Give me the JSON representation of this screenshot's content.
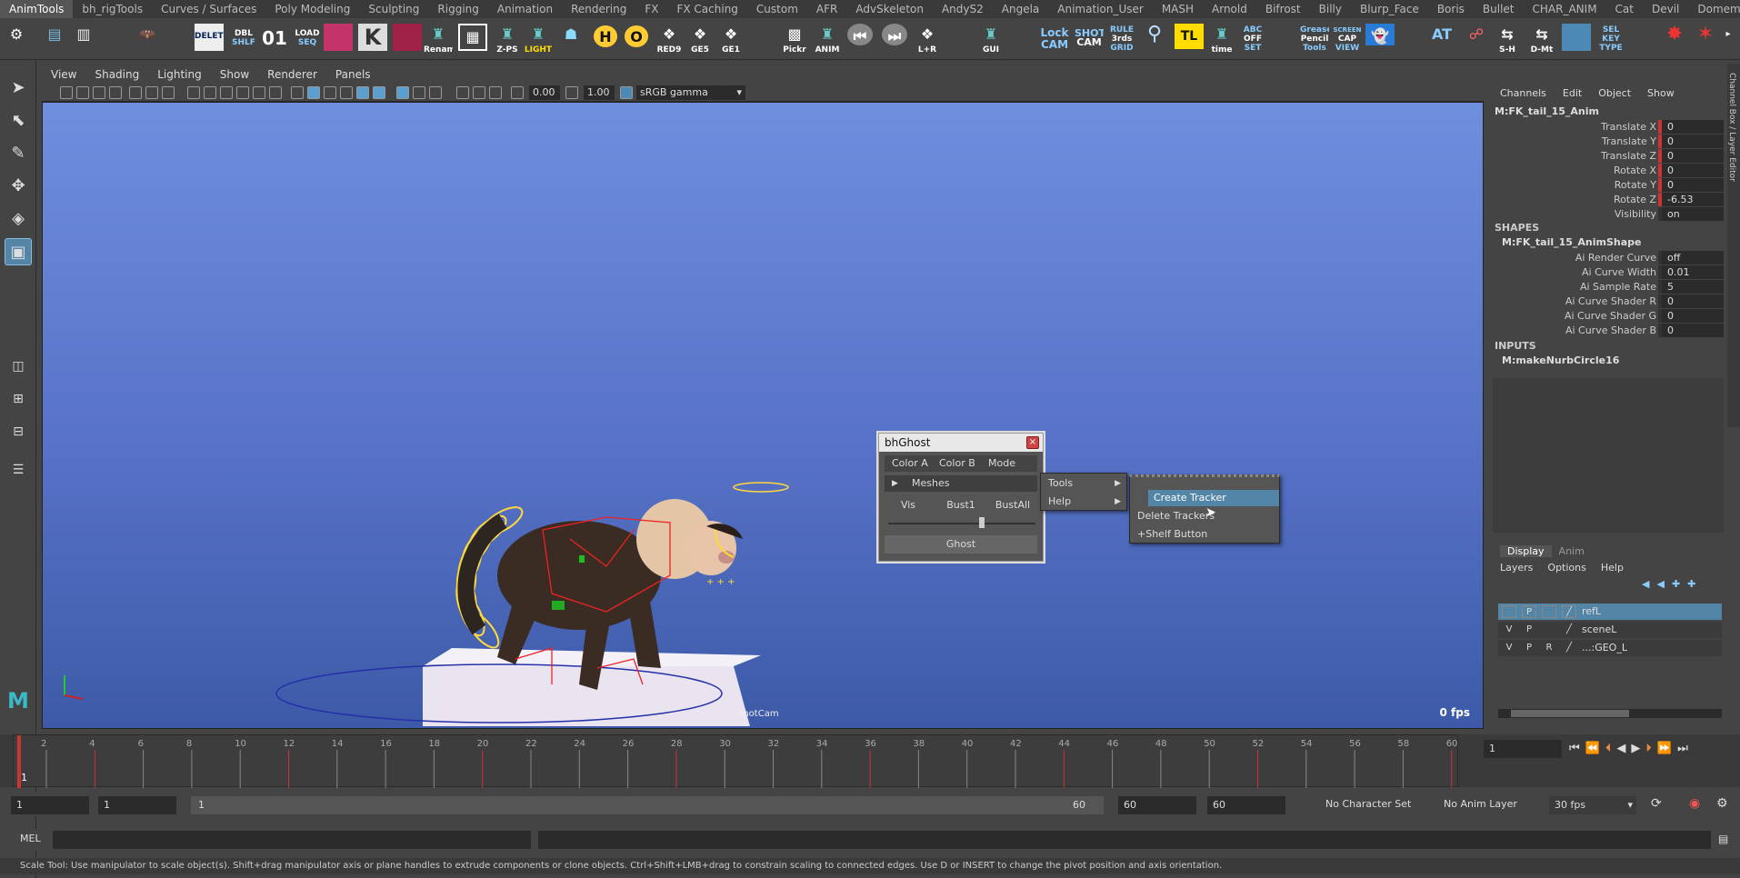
{
  "shelf_tabs": [
    "AnimTools",
    "bh_rigTools",
    "Curves / Surfaces",
    "Poly Modeling",
    "Sculpting",
    "Rigging",
    "Animation",
    "Rendering",
    "FX",
    "FX Caching",
    "Custom",
    "AFR",
    "AdvSkeleton",
    "AndyS2",
    "Angela",
    "Animation_User",
    "MASH",
    "Arnold",
    "Bifrost",
    "Billy",
    "Blurp_Face",
    "Boris",
    "Bullet",
    "CHAR_ANIM",
    "Cat",
    "Devil",
    "Domemaster"
  ],
  "shelf_icons": {
    "delete": "DELETE",
    "dbl": "DBL",
    "shlf": "SHLF",
    "num01": "01",
    "load": "LOAD",
    "seq": "SEQ",
    "rename": "Rename",
    "zps": "Z-PS",
    "light": "LIGHT",
    "h": "H",
    "o": "O",
    "red9": "RED9",
    "ge5": "GE5",
    "ge1": "GE1",
    "pickr": "Pickr",
    "anim": "ANIM",
    "lr": "L+R",
    "gui": "GUI",
    "lock": "Lock",
    "cam": "CAM",
    "shot": "SHOT",
    "shotcam2": "CAM",
    "rule": "RULE",
    "thirds": "3rds",
    "grid": "GRID",
    "tl": "TL",
    "time": "time",
    "abc": "ABC",
    "off": "OFF",
    "set": "SET",
    "grease": "Grease",
    "pencil": "Pencil",
    "tools": "Tools",
    "screen": "SCREEN",
    "cap": "CAP",
    "view": "VIEW",
    "at": "AT",
    "sh": "S-H",
    "dmt": "D-Mt",
    "sel": "SEL",
    "key": "KEY",
    "type": "TYPE"
  },
  "viewport_menu": [
    "View",
    "Shading",
    "Lighting",
    "Show",
    "Renderer",
    "Panels"
  ],
  "viewport_toolbar": {
    "exposure": "0.00",
    "gamma": "1.00",
    "color_space": "sRGB gamma"
  },
  "viewport": {
    "fps": "0 fps",
    "camera_label": "ShotCam"
  },
  "channel_box": {
    "menu": [
      "Channels",
      "Edit",
      "Object",
      "Show"
    ],
    "object_name": "M:FK_tail_15_Anim",
    "channels": [
      {
        "label": "Translate X",
        "value": "0"
      },
      {
        "label": "Translate Y",
        "value": "0"
      },
      {
        "label": "Translate Z",
        "value": "0"
      },
      {
        "label": "Rotate X",
        "value": "0"
      },
      {
        "label": "Rotate Y",
        "value": "0"
      },
      {
        "label": "Rotate Z",
        "value": "-6.53"
      },
      {
        "label": "Visibility",
        "value": "on"
      }
    ],
    "shapes_header": "SHAPES",
    "shape_name": "M:FK_tail_15_AnimShape",
    "shape_channels": [
      {
        "label": "Ai Render Curve",
        "value": "off"
      },
      {
        "label": "Ai Curve Width",
        "value": "0.01"
      },
      {
        "label": "Ai Sample Rate",
        "value": "5"
      },
      {
        "label": "Ai Curve Shader R",
        "value": "0"
      },
      {
        "label": "Ai Curve Shader G",
        "value": "0"
      },
      {
        "label": "Ai Curve Shader B",
        "value": "0"
      }
    ],
    "inputs_header": "INPUTS",
    "input_name": "M:makeNurbCircle16"
  },
  "layer_editor": {
    "tabs": [
      "Display",
      "Anim"
    ],
    "menu": [
      "Layers",
      "Options",
      "Help"
    ],
    "layers": [
      {
        "v": "",
        "p": "P",
        "r": "",
        "name": "refL"
      },
      {
        "v": "V",
        "p": "P",
        "r": "",
        "name": "sceneL"
      },
      {
        "v": "V",
        "p": "P",
        "r": "R",
        "name": "...:GEO_L"
      }
    ]
  },
  "ghost_window": {
    "title": "bhGhost",
    "menu": [
      "Color A",
      "Color B",
      "Mode"
    ],
    "meshes_label": "Meshes",
    "buttons": [
      "Vis",
      "Bust1",
      "BustAll"
    ],
    "ghost_button": "Ghost"
  },
  "popup_menu": {
    "items": [
      "Tools",
      "Help"
    ]
  },
  "submenu": {
    "items": [
      "Create Tracker",
      "Delete Trackers",
      "+Shelf Button"
    ]
  },
  "timeline": {
    "ticks": [
      "2",
      "4",
      "6",
      "8",
      "10",
      "12",
      "14",
      "16",
      "18",
      "20",
      "22",
      "24",
      "26",
      "28",
      "30",
      "32",
      "34",
      "36",
      "38",
      "40",
      "42",
      "44",
      "46",
      "48",
      "50",
      "52",
      "54",
      "56",
      "58",
      "60"
    ],
    "current_frame": "1",
    "frame_field": "1"
  },
  "range": {
    "start": "1",
    "anim_start": "1",
    "slider_start": "1",
    "slider_end": "60",
    "anim_end": "60",
    "end": "60",
    "character_set": "No Character Set",
    "anim_layer": "No Anim Layer",
    "fps": "30 fps"
  },
  "mel": {
    "label": "MEL"
  },
  "help_line": "Scale Tool: Use manipulator to scale object(s). Shift+drag manipulator axis or plane handles to extrude components or clone objects. Ctrl+Shift+LMB+drag to constrain scaling to connected edges. Use D or INSERT to change the pivot position and axis orientation."
}
